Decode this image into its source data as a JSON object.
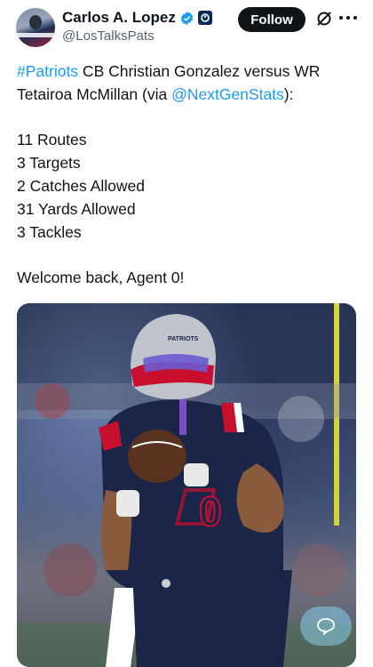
{
  "author": {
    "name": "Carlos A. Lopez",
    "handle": "@LosTalksPats",
    "verified_icon": "verified-badge-icon",
    "affiliate_icon": "affiliate-badge-icon"
  },
  "actions": {
    "follow_label": "Follow",
    "grok_icon": "grok-icon",
    "more_icon": "more-options-icon"
  },
  "tweet": {
    "hashtag": "#Patriots",
    "intro_text": " CB Christian Gonzalez versus WR Tetairoa McMillan (via ",
    "mention": "@NextGenStats",
    "intro_end": "):",
    "stats": [
      "11 Routes",
      "3 Targets",
      "2 Catches Allowed",
      "31 Yards Allowed",
      "3 Tackles"
    ],
    "closing": "Welcome back, Agent 0!"
  },
  "media": {
    "jersey_number": "0",
    "helmet_text": "PATRIOTS",
    "floating_icon": "reply-bubble-icon"
  },
  "colors": {
    "link": "#1d9bf0",
    "text": "#0f1419",
    "secondary": "#536471",
    "follow_bg": "#0f1419"
  }
}
